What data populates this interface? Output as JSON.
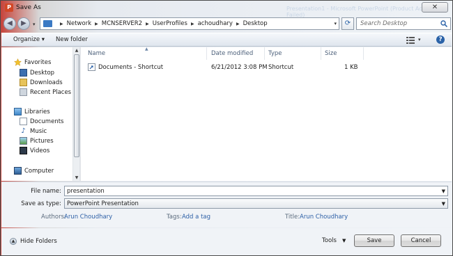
{
  "window": {
    "title": "Save As",
    "background_title": "Presentation1 - Microsoft PowerPoint (Product Activation Failed)",
    "close_label": "✕"
  },
  "address": {
    "breadcrumb": [
      "Network",
      "MCNSERVER2",
      "UserProfiles",
      "achoudhary",
      "Desktop"
    ],
    "search_placeholder": "Search Desktop"
  },
  "toolbar": {
    "organize_label": "Organize ▾",
    "new_folder_label": "New folder"
  },
  "navpane": {
    "favorites_header": "Favorites",
    "favorites": [
      "Desktop",
      "Downloads",
      "Recent Places"
    ],
    "libraries_header": "Libraries",
    "libraries": [
      "Documents",
      "Music",
      "Pictures",
      "Videos"
    ],
    "computer_label": "Computer"
  },
  "filelist": {
    "columns": [
      "Name",
      "Date modified",
      "Type",
      "Size"
    ],
    "rows": [
      {
        "name": "Documents - Shortcut",
        "date": "6/21/2012 3:08 PM",
        "type": "Shortcut",
        "size": "1 KB"
      }
    ]
  },
  "fields": {
    "file_name_label": "File name:",
    "file_name_value": "presentation",
    "save_type_label": "Save as type:",
    "save_type_value": "PowerPoint Presentation",
    "authors_label": "Authors:",
    "authors_value": "Arun Choudhary",
    "tags_label": "Tags:",
    "tags_value": "Add a tag",
    "title_label": "Title:",
    "title_value": "Arun Choudhary"
  },
  "footer": {
    "hide_folders_label": "Hide Folders",
    "tools_label": "Tools",
    "save_label": "Save",
    "cancel_label": "Cancel"
  },
  "colors": {
    "accent_link": "#2c5fa6",
    "powerpoint_red": "#d24726"
  }
}
